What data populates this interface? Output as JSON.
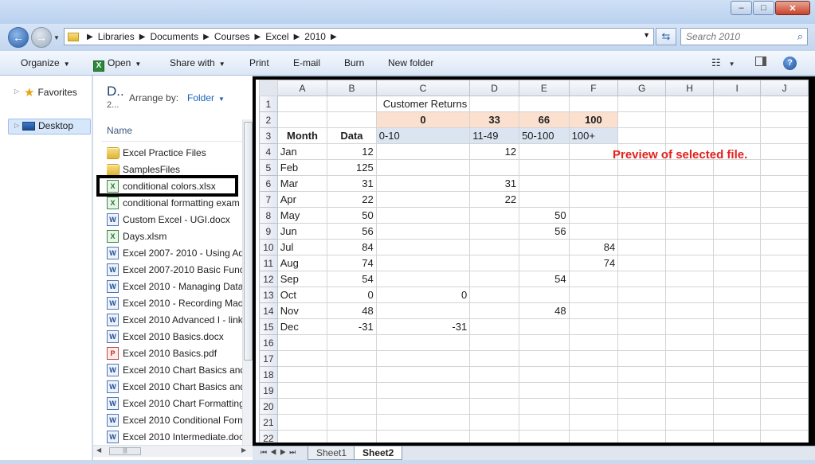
{
  "window": {
    "minimize": "–",
    "maximize": "□",
    "close": "✕"
  },
  "address": {
    "crumbs": [
      "Libraries",
      "Documents",
      "Courses",
      "Excel",
      "2010"
    ],
    "search_placeholder": "Search 2010"
  },
  "toolbar": {
    "organize": "Organize",
    "open": "Open",
    "share_with": "Share with",
    "print": "Print",
    "email": "E-mail",
    "burn": "Burn",
    "new_folder": "New folder"
  },
  "nav": {
    "favorites": "Favorites",
    "desktop": "Desktop"
  },
  "filepane": {
    "library_title": "D..",
    "library_sub": "2...",
    "arrange_label": "Arrange by:",
    "arrange_value": "Folder",
    "column_name": "Name",
    "files": [
      {
        "name": "Excel Practice Files",
        "type": "folder"
      },
      {
        "name": "SamplesFiles",
        "type": "folder"
      },
      {
        "name": "conditional colors.xlsx",
        "type": "xlsx"
      },
      {
        "name": "conditional formatting exam",
        "type": "xlsx"
      },
      {
        "name": "Custom Excel - UGI.docx",
        "type": "docx"
      },
      {
        "name": "Days.xlsm",
        "type": "xlsx"
      },
      {
        "name": "Excel 2007- 2010 - Using Adv",
        "type": "docx"
      },
      {
        "name": "Excel 2007-2010 Basic Functi",
        "type": "docx"
      },
      {
        "name": "Excel 2010 - Managing Data.",
        "type": "docx"
      },
      {
        "name": "Excel 2010 - Recording Macr",
        "type": "docx"
      },
      {
        "name": "Excel 2010 Advanced I - linki",
        "type": "docx"
      },
      {
        "name": "Excel 2010 Basics.docx",
        "type": "docx"
      },
      {
        "name": "Excel 2010 Basics.pdf",
        "type": "pdf"
      },
      {
        "name": "Excel 2010 Chart Basics and",
        "type": "docx"
      },
      {
        "name": "Excel 2010 Chart Basics and",
        "type": "docx"
      },
      {
        "name": "Excel 2010 Chart Formatting",
        "type": "docx"
      },
      {
        "name": "Excel 2010 Conditional Form",
        "type": "docx"
      },
      {
        "name": "Excel 2010 Intermediate.docx",
        "type": "docx"
      }
    ]
  },
  "preview": {
    "note": "Preview of selected file.",
    "columns": [
      "A",
      "B",
      "C",
      "D",
      "E",
      "F",
      "G",
      "H",
      "I",
      "J"
    ],
    "rows": [
      [
        "",
        "",
        "Customer Returns",
        "",
        "",
        "",
        "",
        "",
        "",
        ""
      ],
      [
        "",
        "",
        "0",
        "33",
        "66",
        "100",
        "",
        "",
        "",
        ""
      ],
      [
        "Month",
        "Data",
        "0-10",
        "11-49",
        "50-100",
        "100+",
        "",
        "",
        "",
        ""
      ],
      [
        "Jan",
        "12",
        "",
        "12",
        "",
        "",
        "",
        "",
        "",
        ""
      ],
      [
        "Feb",
        "125",
        "",
        "",
        "",
        "",
        "",
        "",
        "",
        ""
      ],
      [
        "Mar",
        "31",
        "",
        "31",
        "",
        "",
        "",
        "",
        "",
        ""
      ],
      [
        "Apr",
        "22",
        "",
        "22",
        "",
        "",
        "",
        "",
        "",
        ""
      ],
      [
        "May",
        "50",
        "",
        "",
        "50",
        "",
        "",
        "",
        "",
        ""
      ],
      [
        "Jun",
        "56",
        "",
        "",
        "56",
        "",
        "",
        "",
        "",
        ""
      ],
      [
        "Jul",
        "84",
        "",
        "",
        "",
        "84",
        "",
        "",
        "",
        ""
      ],
      [
        "Aug",
        "74",
        "",
        "",
        "",
        "74",
        "",
        "",
        "",
        ""
      ],
      [
        "Sep",
        "54",
        "",
        "",
        "54",
        "",
        "",
        "",
        "",
        ""
      ],
      [
        "Oct",
        "0",
        "0",
        "",
        "",
        "",
        "",
        "",
        "",
        ""
      ],
      [
        "Nov",
        "48",
        "",
        "",
        "48",
        "",
        "",
        "",
        "",
        ""
      ],
      [
        "Dec",
        "-31",
        "-31",
        "",
        "",
        "",
        "",
        "",
        "",
        ""
      ],
      [
        "",
        "",
        "",
        "",
        "",
        "",
        "",
        "",
        "",
        ""
      ],
      [
        "",
        "",
        "",
        "",
        "",
        "",
        "",
        "",
        "",
        ""
      ],
      [
        "",
        "",
        "",
        "",
        "",
        "",
        "",
        "",
        "",
        ""
      ],
      [
        "",
        "",
        "",
        "",
        "",
        "",
        "",
        "",
        "",
        ""
      ],
      [
        "",
        "",
        "",
        "",
        "",
        "",
        "",
        "",
        "",
        ""
      ],
      [
        "",
        "",
        "",
        "",
        "",
        "",
        "",
        "",
        "",
        ""
      ],
      [
        "",
        "",
        "",
        "",
        "",
        "",
        "",
        "",
        "",
        ""
      ]
    ],
    "sheets": [
      "Sheet1",
      "Sheet2"
    ],
    "active_sheet": "Sheet2",
    "accent_colors": {
      "peach": "#fbe0cf",
      "blue": "#dbe5f1",
      "note": "#e4201c"
    }
  }
}
